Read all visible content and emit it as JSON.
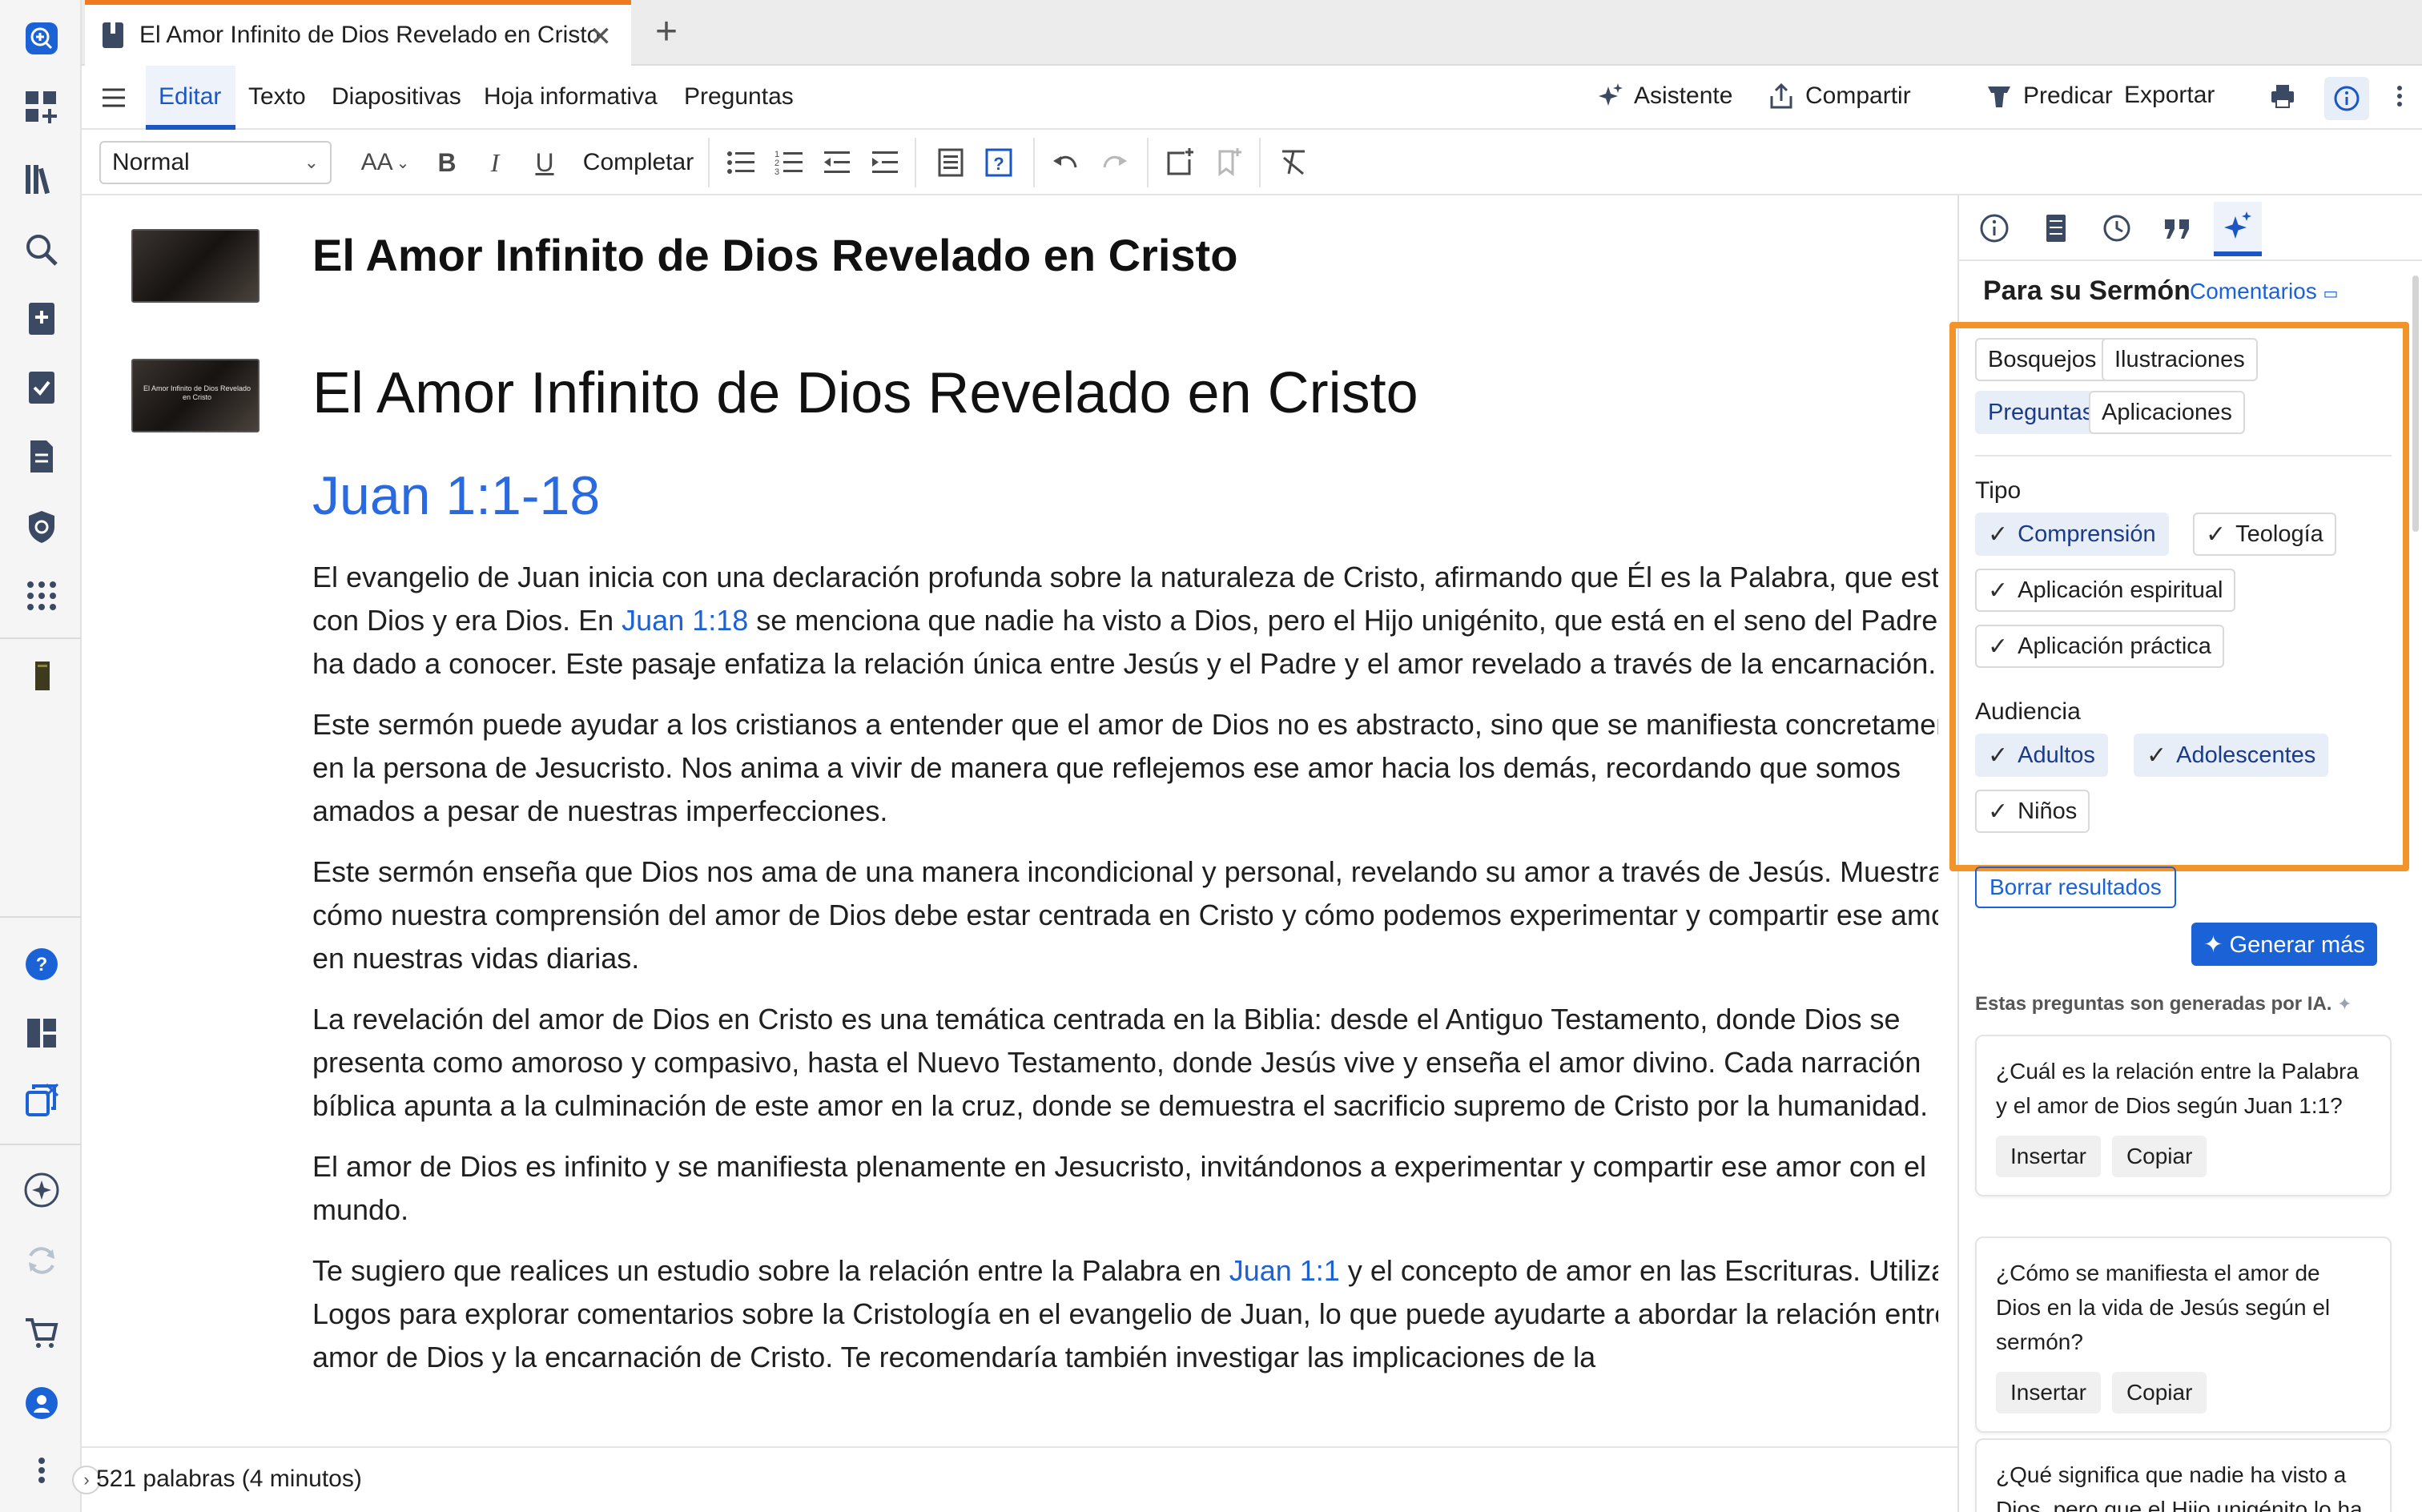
{
  "tab": {
    "title": "El Amor Infinito de Dios Revelado en Cristo",
    "close": "✕",
    "add": "+"
  },
  "menu": {
    "items": [
      "Editar",
      "Texto",
      "Diapositivas",
      "Hoja informativa",
      "Preguntas"
    ],
    "right": {
      "assistant": "Asistente",
      "share": "Compartir",
      "preach": "Predicar",
      "export": "Exportar"
    }
  },
  "format": {
    "style": "Normal",
    "complete": "Completar",
    "bold": "B",
    "italic": "I",
    "underline": "U",
    "font_size": "AA"
  },
  "doc": {
    "heading1": "El Amor Infinito de Dios Revelado en Cristo",
    "slide_thumb_text": "El Amor Infinito de Dios Revelado en Cristo",
    "heading2": "El Amor Infinito de Dios Revelado en Cristo",
    "reference": "Juan 1:1-18",
    "p1_a": "El evangelio de Juan inicia con una declaración profunda sobre la naturaleza de Cristo, afirmando que Él es la Palabra, que estaba con Dios y era Dios. En ",
    "p1_link": "Juan 1:18",
    "p1_b": " se menciona que nadie ha visto a Dios, pero el Hijo unigénito, que está en el seno del Padre, lo ha dado a conocer. Este pasaje enfatiza la relación única entre Jesús y el Padre y el amor revelado a través de la encarnación.",
    "p2": "Este sermón puede ayudar a los cristianos a entender que el amor de Dios no es abstracto, sino que se manifiesta concretamente en la persona de Jesucristo. Nos anima a vivir de manera que reflejemos ese amor hacia los demás, recordando que somos amados a pesar de nuestras imperfecciones.",
    "p3": "Este sermón enseña que Dios nos ama de una manera incondicional y personal, revelando su amor a través de Jesús. Muestra cómo nuestra comprensión del amor de Dios debe estar centrada en Cristo y cómo podemos experimentar y compartir ese amor en nuestras vidas diarias.",
    "p4": "La revelación del amor de Dios en Cristo es una temática centrada en la Biblia: desde el Antiguo Testamento, donde Dios se presenta como amoroso y compasivo, hasta el Nuevo Testamento, donde Jesús vive y enseña el amor divino. Cada narración bíblica apunta a la culminación de este amor en la cruz, donde se demuestra el sacrificio supremo de Cristo por la humanidad.",
    "p5": "El amor de Dios es infinito y se manifiesta plenamente en Jesucristo, invitándonos a experimentar y compartir ese amor con el mundo.",
    "p6_a": "Te sugiero que realices un estudio sobre la relación entre la Palabra en ",
    "p6_link": "Juan 1:1",
    "p6_b": " y el concepto de amor en las Escrituras. Utiliza Logos para explorar comentarios sobre la Cristología en el evangelio de Juan, lo que puede ayudarte a abordar la relación entre el amor de Dios y la encarnación de Cristo. Te recomendaría también investigar las implicaciones de la"
  },
  "status": {
    "words": "521 palabras (4 minutos)",
    "chevron": "›"
  },
  "panel": {
    "title": "Para su Sermón",
    "comments_link": "Comentarios",
    "categories": [
      "Bosquejos",
      "Ilustraciones",
      "Preguntas",
      "Aplicaciones"
    ],
    "selected_category": "Preguntas",
    "type_label": "Tipo",
    "types": [
      "Comprensión",
      "Teología",
      "Aplicación espiritual",
      "Aplicación práctica"
    ],
    "audience_label": "Audiencia",
    "audiences": [
      "Adultos",
      "Adolescentes",
      "Niños"
    ],
    "check": "✓",
    "clear_button": "Borrar resultados",
    "generate_button": "✦ Generar más",
    "ai_note": "Estas preguntas son generadas por IA.",
    "questions": [
      "¿Cuál es la relación entre la Palabra y el amor de Dios según Juan 1:1?",
      "¿Cómo se manifiesta el amor de Dios en la vida de Jesús según el sermón?",
      "¿Qué significa que nadie ha visto a Dios, pero que el Hijo unigénito lo ha dado a conocer?"
    ],
    "insert_label": "Insertar",
    "copy_label": "Copiar"
  },
  "colors": {
    "accent": "#1a62d6",
    "highlight": "#f2942a",
    "tab_accent": "#f07a20"
  }
}
